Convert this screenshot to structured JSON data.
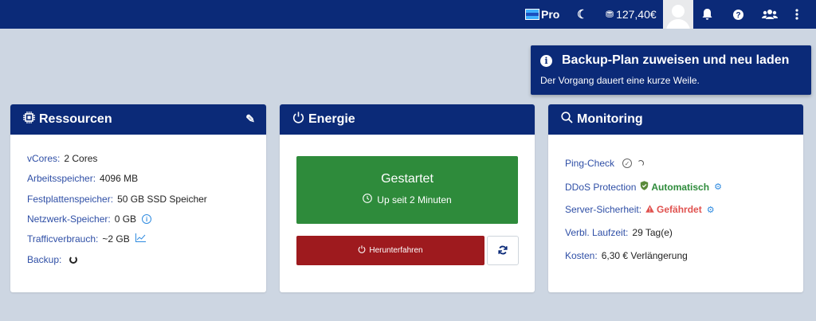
{
  "topbar": {
    "pro_label": "Pro",
    "balance": "127,40€",
    "icons": [
      "pro-icon",
      "moon-icon",
      "coins-icon",
      "avatar",
      "bell-icon",
      "help-icon",
      "users-icon",
      "more-icon"
    ]
  },
  "toast": {
    "title": "Backup-Plan zuweisen und neu laden",
    "subtitle": "Der Vorgang dauert eine kurze Weile."
  },
  "resources": {
    "title": "Ressourcen",
    "rows": [
      {
        "label": "vCores:",
        "value": "2 Cores"
      },
      {
        "label": "Arbeitsspeicher:",
        "value": "4096 MB"
      },
      {
        "label": "Festplattenspeicher:",
        "value": "50 GB SSD Speicher"
      },
      {
        "label": "Netzwerk-Speicher:",
        "value": "0 GB"
      },
      {
        "label": "Trafficverbrauch:",
        "value": "~2 GB"
      },
      {
        "label": "Backup:",
        "value": ""
      }
    ]
  },
  "energy": {
    "title": "Energie",
    "status": "Gestartet",
    "uptime": "Up seit 2 Minuten",
    "shutdown_label": "Herunterfahren",
    "colors": {
      "status": "#2e8b3b",
      "shutdown": "#9e1a1e"
    }
  },
  "monitoring": {
    "title": "Monitoring",
    "ping_label": "Ping-Check",
    "ddos_label": "DDoS Protection",
    "ddos_value": "Automatisch",
    "security_label": "Server-Sicherheit:",
    "security_value": "Gefährdet",
    "runtime_label": "Verbl. Laufzeit:",
    "runtime_value": "29 Tag(e)",
    "cost_label": "Kosten:",
    "cost_value": "6,30 € Verlängerung"
  },
  "colors": {
    "navy": "#0b2a78",
    "background": "#cdd6e2",
    "link": "#2f4fa6",
    "danger": "#e0524f",
    "success": "#2e8b3b"
  }
}
